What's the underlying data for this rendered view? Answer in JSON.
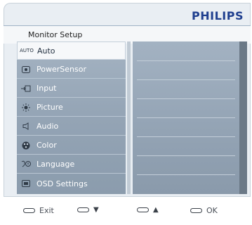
{
  "brand": "PHILIPS",
  "header": {
    "title": "Monitor Setup"
  },
  "menu": {
    "items": [
      {
        "label": "Auto",
        "icon_text": "AUTO",
        "icon": "auto-icon",
        "selected": true
      },
      {
        "label": "PowerSensor",
        "icon": "powersensor-icon"
      },
      {
        "label": "Input",
        "icon": "input-icon"
      },
      {
        "label": "Picture",
        "icon": "picture-icon"
      },
      {
        "label": "Audio",
        "icon": "speaker-icon"
      },
      {
        "label": "Color",
        "icon": "color-palette-icon"
      },
      {
        "label": "Language",
        "icon": "language-icon"
      },
      {
        "label": "OSD Settings",
        "icon": "osd-settings-icon"
      }
    ]
  },
  "controls": [
    {
      "label": "Exit",
      "icon": "button-pill-icon"
    },
    {
      "label": "▼",
      "icon": "button-pill-icon"
    },
    {
      "label": "▲",
      "icon": "button-pill-icon"
    },
    {
      "label": "OK",
      "icon": "button-pill-icon"
    }
  ],
  "colors": {
    "brand": "#1f3f8f",
    "menu_bg": "#9aaaba",
    "selected_bg": "#f6f8fa"
  }
}
